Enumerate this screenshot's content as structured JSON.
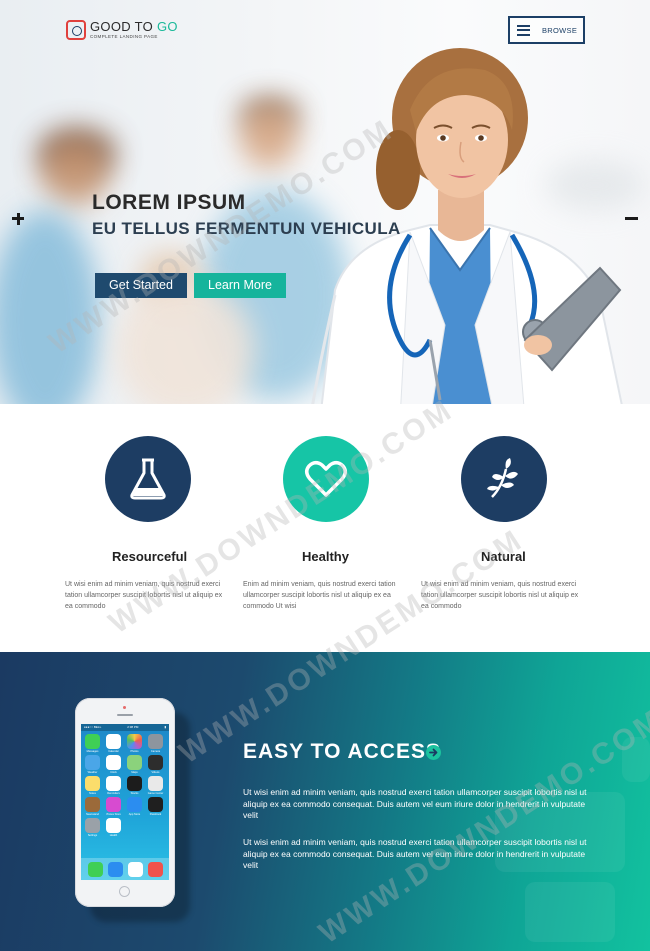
{
  "header": {
    "logo_title_main": "GOOD TO ",
    "logo_title_accent": "GO",
    "logo_subtitle": "COMPLETE LANDING PAGE",
    "browse_label": "BROWSE"
  },
  "hero": {
    "title": "LOREM IPSUM",
    "subtitle": "EU TELLUS FERMENTUN VEHICULA",
    "primary_button": "Get Started",
    "secondary_button": "Learn More"
  },
  "features": [
    {
      "title": "Resourceful",
      "icon": "flask-icon",
      "color": "#1d3d63",
      "text": "Ut wisi enim ad minim veniam, quis nostrud exerci tation ullamcorper suscipit lobortis nisl ut aliquip ex ea commodo"
    },
    {
      "title": "Healthy",
      "icon": "heart-icon",
      "color": "#16c5a6",
      "text": "Enim ad minim veniam, quis nostrud exerci tation ullamcorper suscipit lobortis nisl ut aliquip ex ea commodo Ut wisi"
    },
    {
      "title": "Natural",
      "icon": "leaf-icon",
      "color": "#1d3d63",
      "text": "Ut wisi enim ad minim veniam, quis nostrud exerci tation ullamcorper suscipit lobortis nisl ut aliquip ex ea commodo"
    }
  ],
  "access": {
    "title": "EASY TO ACCESS",
    "paragraph1": "Ut wisi enim ad minim veniam, quis nostrud exerci tation ullamcorper suscipit lobortis nisl ut aliquip ex ea commodo consequat. Duis autem vel eum iriure dolor in hendrerit in vulputate velit",
    "paragraph2": "Ut wisi enim ad minim veniam, quis nostrud exerci tation ullamcorper suscipit lobortis nisl ut aliquip ex ea commodo consequat. Duis autem vel eum iriure dolor in hendrerit in vulputate velit"
  },
  "phone": {
    "carrier": "●●●○○ BELL",
    "time": "2:38 PM",
    "apps": [
      "Messages",
      "Calendar",
      "Photos",
      "Camera",
      "Weather",
      "Clock",
      "Maps",
      "Videos",
      "Notes",
      "Reminders",
      "Stocks",
      "Game Center",
      "Newsstand",
      "iTunes Store",
      "App Store",
      "Passbook",
      "Settings",
      "Health",
      "",
      ""
    ]
  },
  "watermark": "WWW.DOWNDEMO.COM",
  "colors": {
    "navy": "#1d3d63",
    "teal": "#16b49c",
    "logo_red": "#e0403c"
  }
}
